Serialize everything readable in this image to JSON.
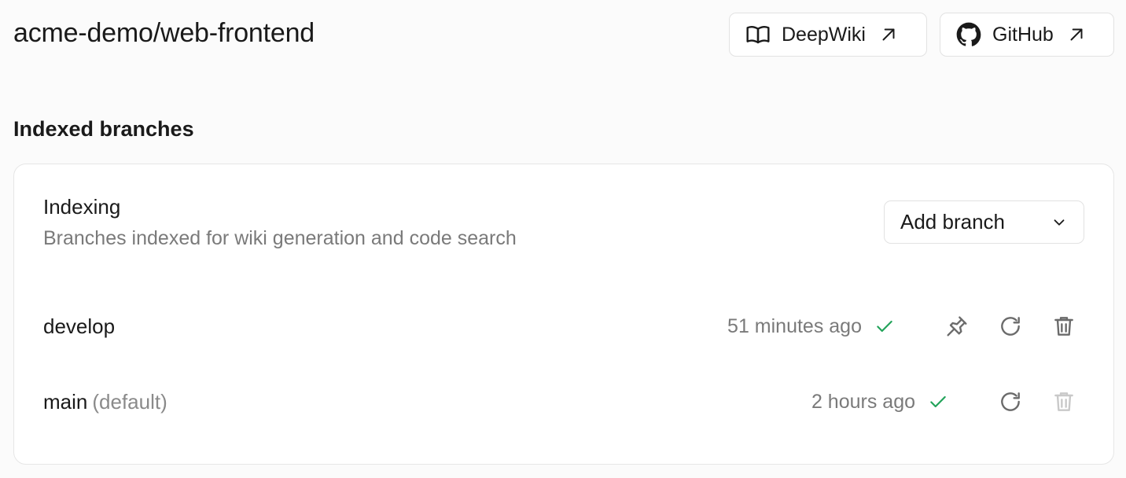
{
  "repo": {
    "title": "acme-demo/web-frontend"
  },
  "header": {
    "deepwiki_label": "DeepWiki",
    "github_label": "GitHub"
  },
  "icons": {
    "deepwiki": "book-open-icon",
    "github": "github-icon",
    "external": "arrow-up-right-icon",
    "chevron": "chevron-down-icon",
    "check": "check-icon",
    "pin": "pin-icon",
    "refresh": "refresh-icon",
    "delete": "trash-icon"
  },
  "section": {
    "title": "Indexed branches"
  },
  "indexing": {
    "title": "Indexing",
    "subtitle": "Branches indexed for wiki generation and code search",
    "add_branch_label": "Add branch"
  },
  "branches": [
    {
      "name": "develop",
      "tag": "",
      "updated": "51 minutes ago",
      "status": "indexed",
      "pinnable": true,
      "deletable": true
    },
    {
      "name": "main",
      "tag": "(default)",
      "updated": "2 hours ago",
      "status": "indexed",
      "pinnable": false,
      "deletable": false
    }
  ],
  "colors": {
    "success": "#22a35a",
    "muted_text": "#7a7a7a",
    "icon": "#6b6b6b",
    "icon_disabled": "#c9c9c9",
    "border": "#e2e2e2",
    "background": "#fbfbfb"
  }
}
